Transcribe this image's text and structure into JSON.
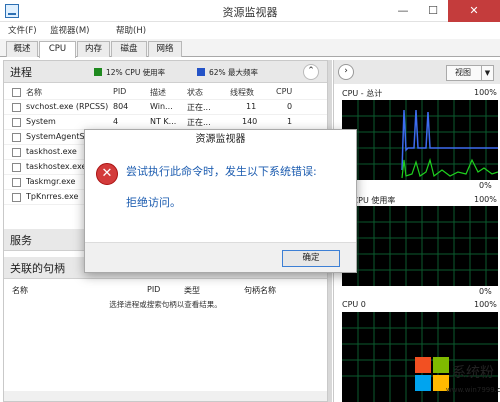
{
  "window": {
    "title": "资源监视器",
    "min": "—",
    "max": "☐",
    "close": "✕"
  },
  "menu": [
    "文件(F)",
    "监视器(M)",
    "帮助(H)"
  ],
  "tabs": [
    {
      "label": "概述",
      "active": false
    },
    {
      "label": "CPU",
      "active": true
    },
    {
      "label": "内存",
      "active": false
    },
    {
      "label": "磁盘",
      "active": false
    },
    {
      "label": "网络",
      "active": false
    }
  ],
  "processes": {
    "title": "进程",
    "cpu_usage": "12% CPU 使用率",
    "max_freq": "62% 最大频率",
    "cpu_color": "#1f8a1f",
    "freq_color": "#2453c7",
    "columns": [
      "名称",
      "PID",
      "描述",
      "状态",
      "线程数",
      "CPU"
    ],
    "rows": [
      [
        "svchost.exe (RPCSS)",
        "804",
        "Win...",
        "正在...",
        "11",
        "0"
      ],
      [
        "System",
        "4",
        "NT K...",
        "正在...",
        "140",
        "1"
      ],
      [
        "SystemAgentS...",
        "",
        "",
        "",
        "",
        ""
      ],
      [
        "taskhost.exe",
        "",
        "",
        "",
        "",
        ""
      ],
      [
        "taskhostex.exe",
        "",
        "",
        "",
        "",
        ""
      ],
      [
        "Taskmgr.exe",
        "",
        "",
        "",
        "",
        ""
      ],
      [
        "TpKnrres.exe",
        "",
        "",
        "",
        "",
        ""
      ]
    ]
  },
  "services": {
    "title": "服务"
  },
  "handles": {
    "title": "关联的句柄",
    "columns": [
      "名称",
      "PID",
      "类型",
      "句柄名称"
    ],
    "message": "选择进程或搜索句柄以查看结果。"
  },
  "right_panel": {
    "view_label": "视图",
    "graphs": [
      {
        "label": "CPU - 总计",
        "top_pct": "100%",
        "bottom_left": "秒",
        "bottom_pct": "0%"
      },
      {
        "label": "务 CPU 使用率",
        "top_pct": "100%",
        "bottom_left": "",
        "bottom_pct": "0%"
      },
      {
        "label": "CPU 0",
        "top_pct": "100%",
        "bottom_left": "",
        "bottom_pct": ""
      }
    ]
  },
  "dialog": {
    "title": "资源监视器",
    "message": "尝试执行此命令时，发生以下系统错误:",
    "detail": "拒绝访问。",
    "ok": "确定",
    "icon": "✕"
  },
  "watermark": {
    "text": "系统粉",
    "url": "www.win7999.com"
  },
  "colors": {
    "accent": "#3c7fd5",
    "error": "#d33b3b",
    "graph_line": "#1fd11f",
    "graph_line2": "#3d6cf0"
  }
}
